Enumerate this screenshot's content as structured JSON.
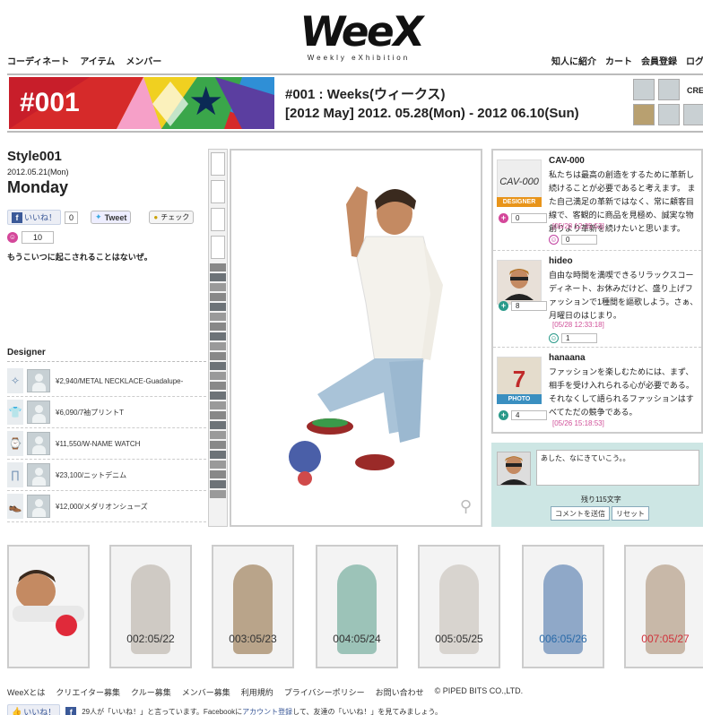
{
  "header": {
    "logo_text": "WeeX",
    "logo_subtitle": "Weekly eXhibition",
    "nav_left": [
      "コーディネート",
      "アイテム",
      "メンバー"
    ],
    "nav_right": [
      "知人に紹介",
      "カート",
      "会員登録",
      "ログイ"
    ]
  },
  "banner": {
    "number": "#001",
    "title": "#001 : Weeks(ウィークス)",
    "dates": "[2012 May] 2012. 05.28(Mon) - 2012 06.10(Sun)",
    "crew_label": "CREW"
  },
  "style": {
    "title": "Style001",
    "date": "2012.05.21(Mon)",
    "day": "Monday",
    "like_label": "いいね！",
    "like_count": "0",
    "tweet_label": "Tweet",
    "check_label": "チェック",
    "love_count": "10",
    "comment": "もうこいつに起こされることはないぜ。"
  },
  "designer": {
    "heading": "Designer",
    "items": [
      {
        "label": "¥2,940/METAL NECKLACE-Guadalupe-"
      },
      {
        "label": "¥6,090/7袖プリントT"
      },
      {
        "label": "¥11,550/W-NAME WATCH"
      },
      {
        "label": "¥23,100/ニットデニム"
      },
      {
        "label": "¥12,000/メダリオンシューズ"
      }
    ]
  },
  "comments": [
    {
      "name": "CAV-000",
      "avatar_text": "CAV-000",
      "badge": "DESIGNER",
      "plus_count": "0",
      "body": "私たちは最高の創造をするために革新し続けることが必要であると考えます。 また自己満足の革新ではなく、常に顧客目線で、客観的に商品を見極め、誠実な物創りより革新を続けたいと思います。",
      "time": "[05/28 12:35:53]",
      "vote_count": "0"
    },
    {
      "name": "hideo",
      "avatar_text": "",
      "badge": "",
      "plus_count": "8",
      "body": "自由な時間を満喫できるリラックスコーディネート、お休みだけど、盛り上げファッションで1種間を謳歌しよう。さぁ、月曜日のはじまり。",
      "time": "[05/28 12:33:18]",
      "vote_count": "1"
    },
    {
      "name": "hanaana",
      "avatar_text": "7",
      "badge": "PHOTO",
      "plus_count": "4",
      "body": "ファッションを楽しむためには、まず、相手を受け入れられる心が必要である。それなくして語られるファッションはすべてただの競争である。",
      "time": "[05/26 15:18:53]",
      "vote_count": ""
    }
  ],
  "comment_form": {
    "text": "あした、なにきていこう。。",
    "remaining": "残り115文字",
    "submit_label": "コメントを送信",
    "reset_label": "リセット"
  },
  "thumbs": [
    {
      "label": "",
      "color": "#333333"
    },
    {
      "label": "002:05/22",
      "color": "#333333"
    },
    {
      "label": "003:05/23",
      "color": "#333333"
    },
    {
      "label": "004:05/24",
      "color": "#333333"
    },
    {
      "label": "005:05/25",
      "color": "#333333"
    },
    {
      "label": "006:05/26",
      "color": "#2a6aa8"
    },
    {
      "label": "007:05/27",
      "color": "#d0303a"
    }
  ],
  "footer": {
    "links": [
      "WeeXとは",
      "クリエイター募集",
      "クルー募集",
      "メンバー募集",
      "利用規約",
      "プライバシーポリシー",
      "お問い合わせ",
      "© PIPED BITS CO.,LTD."
    ],
    "fb_like_label": "いいね！",
    "fb_text_pre": "29人が「いいね！」と言っています。Facebookに",
    "fb_link": "アカウント登録",
    "fb_text_post": "して、友達の「いいね！」を見てみましょう。"
  },
  "colors": {
    "accent_pink": "#d4479a",
    "designer_badge": "#e8941a",
    "photo_badge": "#3a8fc0",
    "form_bg": "#cde6e4"
  }
}
